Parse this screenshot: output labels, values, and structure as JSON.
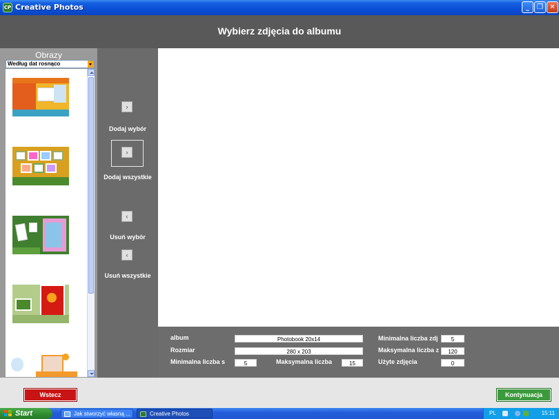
{
  "window": {
    "title": "Creative Photos",
    "app_icon": "creative-photos-icon",
    "minimize": "_",
    "maximize": "❐",
    "close": "✕"
  },
  "header": {
    "heading": "Wybierz zdjęcia do albumu"
  },
  "gallery": {
    "title": "Obrazy",
    "sort_value": "Według dat rosnąco",
    "thumbnails": [
      "template-1",
      "template-2",
      "template-3",
      "template-4",
      "template-5"
    ]
  },
  "actions": {
    "add_selection_arrow": "›",
    "add_selection_label": "Dodaj wybór",
    "add_all_arrow": "›",
    "add_all_label": "Dodaj wszystkie",
    "remove_selection_arrow": "‹",
    "remove_selection_label": "Usuń wybór",
    "remove_all_arrow": "‹",
    "remove_all_label": "Usuń wszystkie"
  },
  "info": {
    "album_label": "album",
    "album_value": "Photobook 20x14",
    "size_label": "Rozmiar",
    "size_value": "280 x 203",
    "min_pages_label": "Minimalna liczba s",
    "min_pages_value": "5",
    "max_pages_label": "Maksymalna liczba",
    "max_pages_value": "15",
    "min_photos_label": "Minimalna liczba zdj",
    "min_photos_value": "5",
    "max_photos_label": "Maksymalna liczba z",
    "max_photos_value": "120",
    "used_photos_label": "Użyte zdjęcia",
    "used_photos_value": "0"
  },
  "footer": {
    "back_label": "Wstecz",
    "continue_label": "Kontynuacja"
  },
  "taskbar": {
    "start_label": "Start",
    "tasks": [
      "Jak stworzyć własną ...",
      "Creative Photos"
    ],
    "language": "PL",
    "clock": "15:11"
  }
}
